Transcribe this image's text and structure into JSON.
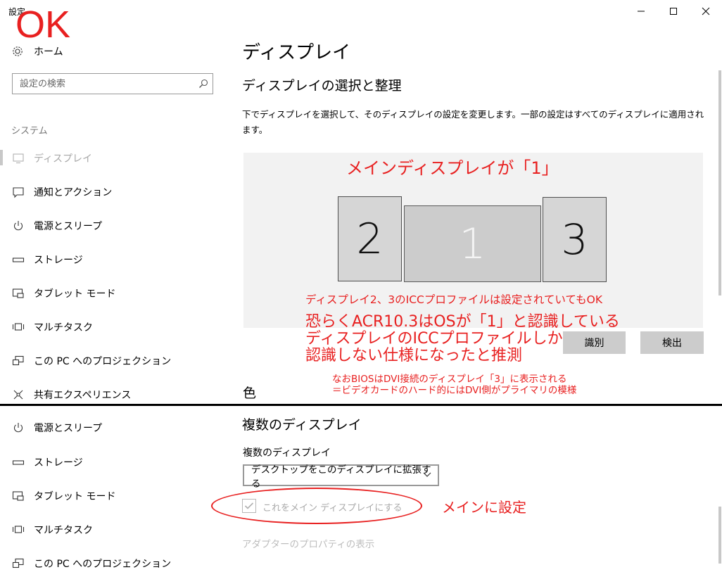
{
  "window": {
    "title": "設定",
    "minimize_glyph": "minimize-icon",
    "maximize_glyph": "maximize-icon",
    "close_glyph": "close-icon"
  },
  "sidebar": {
    "home": "ホーム",
    "search_placeholder": "設定の検索",
    "section": "システム",
    "items": [
      {
        "label": "ディスプレイ",
        "icon": "monitor-icon",
        "selected": true
      },
      {
        "label": "通知とアクション",
        "icon": "notification-icon"
      },
      {
        "label": "電源とスリープ",
        "icon": "power-icon"
      },
      {
        "label": "ストレージ",
        "icon": "storage-icon"
      },
      {
        "label": "タブレット モード",
        "icon": "tablet-mode-icon"
      },
      {
        "label": "マルチタスク",
        "icon": "multitask-icon"
      },
      {
        "label": "この PC へのプロジェクション",
        "icon": "projection-icon"
      },
      {
        "label": "共有エクスペリエンス",
        "icon": "shared-experience-icon"
      }
    ],
    "items_lower": [
      {
        "label": "電源とスリープ",
        "icon": "power-icon"
      },
      {
        "label": "ストレージ",
        "icon": "storage-icon"
      },
      {
        "label": "タブレット モード",
        "icon": "tablet-mode-icon"
      },
      {
        "label": "マルチタスク",
        "icon": "multitask-icon"
      },
      {
        "label": "この PC へのプロジェクション",
        "icon": "projection-icon"
      }
    ]
  },
  "main": {
    "title": "ディスプレイ",
    "subtitle": "ディスプレイの選択と整理",
    "description": "下でディスプレイを選択して、そのディスプレイの設定を変更します。一部の設定はすべてのディスプレイに適用されます。",
    "monitors": [
      "2",
      "1",
      "3"
    ],
    "identify_button": "識別",
    "detect_button": "検出",
    "color_heading": "色",
    "multi_heading": "複数のディスプレイ",
    "multi_label": "複数のディスプレイ",
    "multi_select_value": "デスクトップをこのディスプレイに拡張する",
    "make_main_checkbox": "これをメイン ディスプレイにする",
    "adapter_link": "アダプターのプロパティの表示"
  },
  "annotations": {
    "ok": "OK",
    "main_is_1": "メインディスプレイが「1」",
    "icc_note": "ディスプレイ2、3のICCプロファイルは設定されていてもOK",
    "main_note": "恐らくACR10.3はOSが「1」と認識している\nディスプレイのICCプロファイルしか\n認識しない仕様になったと推測",
    "bios_note": "なおBIOSはDVI接続のディスプレイ「3」に表示される\n＝ビデオカードのハード的にはDVI側がプライマリの模様",
    "set_main": "メインに設定",
    "color": "#e82020"
  }
}
